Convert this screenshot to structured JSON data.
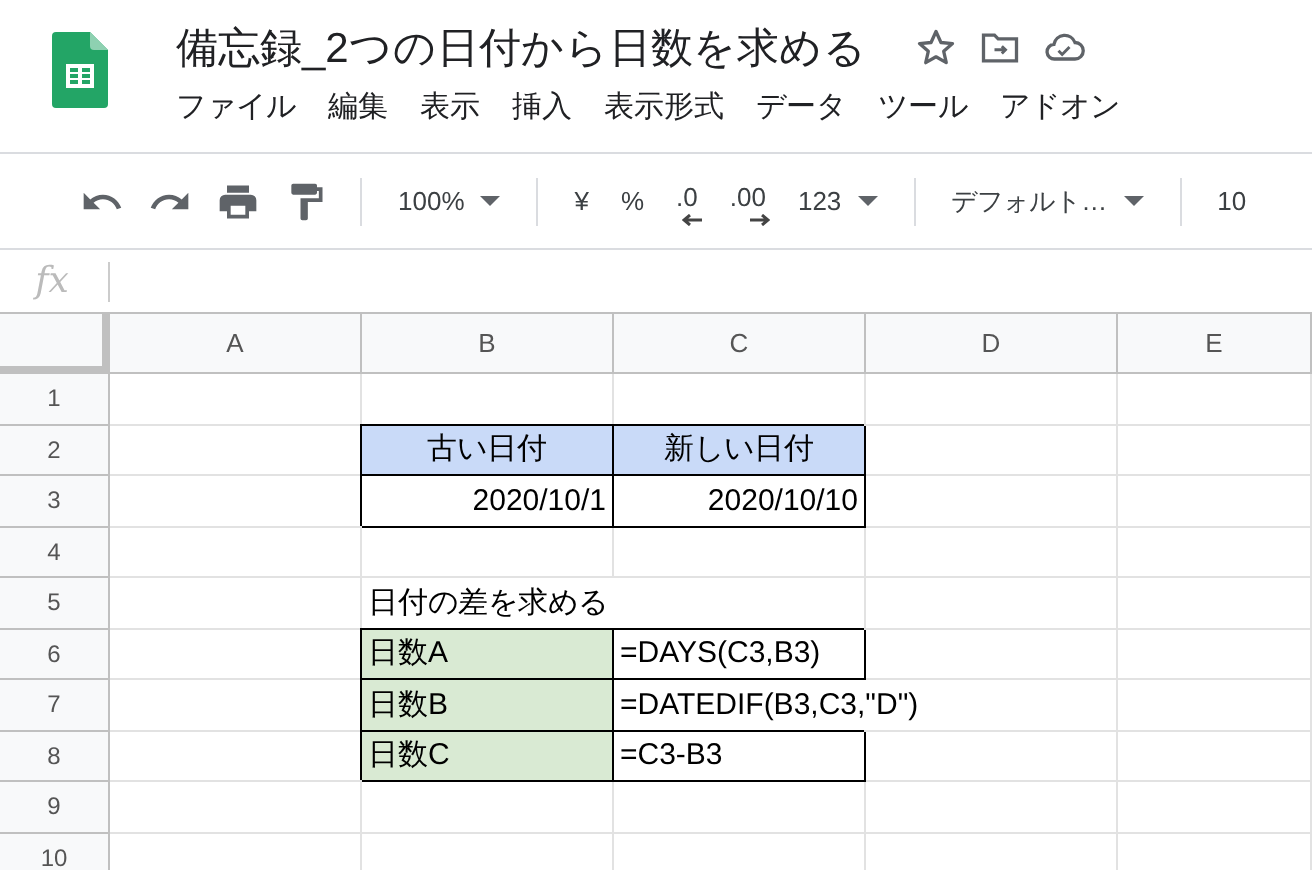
{
  "document": {
    "title": "備忘録_2つの日付から日数を求める"
  },
  "menu": [
    "ファイル",
    "編集",
    "表示",
    "挿入",
    "表示形式",
    "データ",
    "ツール",
    "アドオン"
  ],
  "toolbar": [
    {
      "kind": "undo"
    },
    {
      "kind": "redo"
    },
    {
      "kind": "print"
    },
    {
      "kind": "paint"
    },
    {
      "kind": "sep"
    },
    {
      "kind": "dropdown",
      "label": "100%"
    },
    {
      "kind": "sep"
    },
    {
      "kind": "text",
      "label": "¥"
    },
    {
      "kind": "text",
      "label": "%"
    },
    {
      "kind": "decimal-less",
      "label": ".0"
    },
    {
      "kind": "decimal-more",
      "label": ".00"
    },
    {
      "kind": "dropdown",
      "label": "123"
    },
    {
      "kind": "sep"
    },
    {
      "kind": "dropdown",
      "label": "デフォルト…"
    },
    {
      "kind": "sep"
    },
    {
      "kind": "text",
      "label": "10"
    }
  ],
  "formula_bar": {
    "label": "fx"
  },
  "columns": [
    "A",
    "B",
    "C",
    "D",
    "E"
  ],
  "rows": [
    {
      "label": "1",
      "cells": [
        {},
        {},
        {},
        {},
        {}
      ]
    },
    {
      "label": "2",
      "cells": [
        {},
        {
          "text": "古い日付",
          "color": "#c9daf8",
          "bordered": true,
          "kind": "heading"
        },
        {
          "text": "新しい日付",
          "color": "#c9daf8",
          "bordered": true,
          "kind": "heading"
        },
        {},
        {}
      ]
    },
    {
      "label": "3",
      "cells": [
        {},
        {
          "text": "2020/10/1",
          "bordered": true,
          "kind": "date"
        },
        {
          "text": "2020/10/10",
          "bordered": true,
          "kind": "date"
        },
        {},
        {}
      ]
    },
    {
      "label": "4",
      "cells": [
        {},
        {},
        {},
        {},
        {}
      ]
    },
    {
      "label": "5",
      "cells": [
        {},
        {
          "text": "日付の差を求める"
        },
        {},
        {},
        {}
      ]
    },
    {
      "label": "6",
      "cells": [
        {},
        {
          "text": "日数A",
          "color": "#d9ead3",
          "bordered": true
        },
        {
          "text": "=DAYS(C3,B3)",
          "bordered": true
        },
        {},
        {}
      ]
    },
    {
      "label": "7",
      "cells": [
        {},
        {
          "text": "日数B",
          "color": "#d9ead3",
          "bordered": true
        },
        {
          "text": "=DATEDIF(B3,C3,\"D\")"
        },
        {},
        {}
      ]
    },
    {
      "label": "8",
      "cells": [
        {},
        {
          "text": "日数C",
          "color": "#d9ead3",
          "bordered": true
        },
        {
          "text": "=C3-B3",
          "bordered": true
        },
        {},
        {}
      ]
    },
    {
      "label": "9",
      "cells": [
        {},
        {},
        {},
        {},
        {}
      ]
    },
    {
      "label": "10",
      "cells": [
        {},
        {},
        {},
        {},
        {}
      ]
    }
  ]
}
